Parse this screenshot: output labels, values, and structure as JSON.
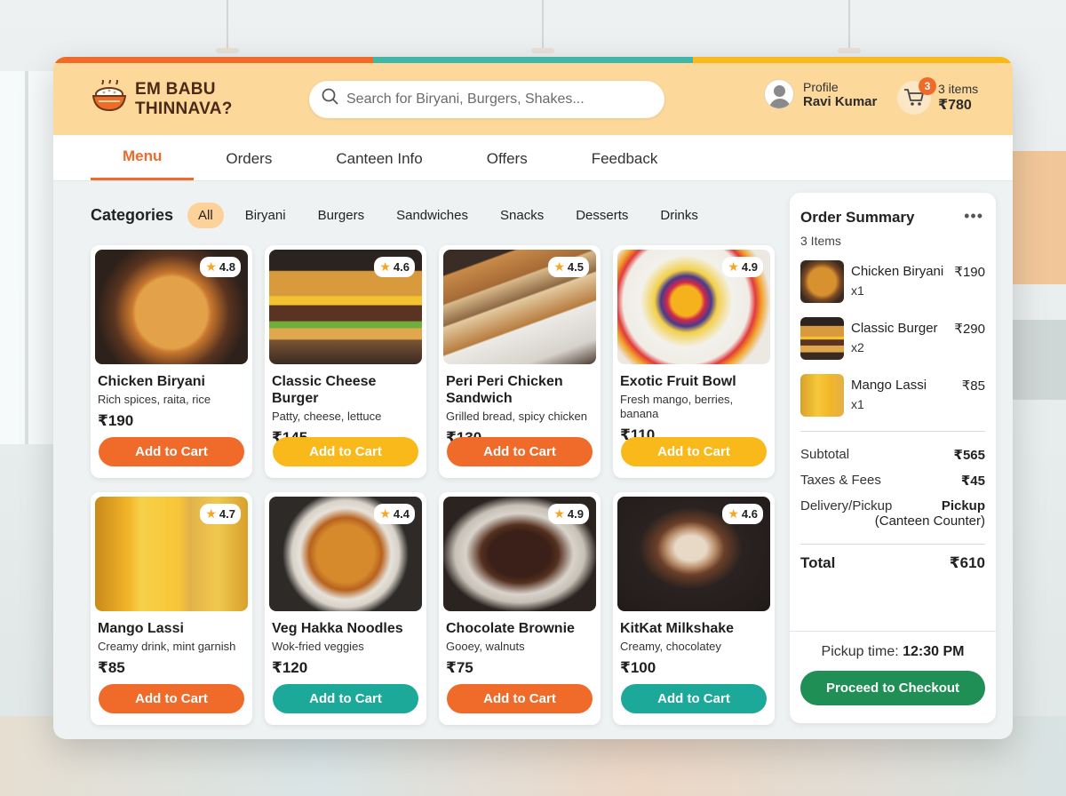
{
  "app": {
    "name": "EM BABU THINNAVA?",
    "name_line1": "EM BABU",
    "name_line2": "THINNAVA?"
  },
  "colors": {
    "header_bg": "#fdd89b",
    "accent_orange": "#f06a2a",
    "accent_yellow": "#f9b91b",
    "accent_teal": "#1ca99a",
    "checkout_green": "#1f8f55"
  },
  "search": {
    "placeholder": "Search for Biryani, Burgers, Shakes...",
    "value": ""
  },
  "profile": {
    "label": "Profile",
    "name": "Ravi Kumar"
  },
  "cart": {
    "badge": "3",
    "items": "3 items",
    "total": "₹780"
  },
  "nav": {
    "tabs": [
      "Menu",
      "Orders",
      "Canteen Info",
      "Offers",
      "Feedback"
    ],
    "active": "Menu"
  },
  "categories": {
    "title": "Categories",
    "items": [
      "All",
      "Biryani",
      "Burgers",
      "Sandwiches",
      "Snacks",
      "Desserts",
      "Drinks"
    ],
    "active": "All"
  },
  "products": [
    {
      "name": "Chicken Biryani",
      "desc": "Rich spices, raita, rice",
      "price": "₹190",
      "rating": "4.8",
      "button": "Add to Cart",
      "button_color": "orange",
      "image_icon": "biryani-image"
    },
    {
      "name": "Classic Cheese Burger",
      "desc": "Patty, cheese, lettuce",
      "price": "₹145",
      "rating": "4.6",
      "button": "Add to Cart",
      "button_color": "yellow",
      "image_icon": "burger-image"
    },
    {
      "name": "Peri Peri Chicken Sandwich",
      "desc": "Grilled bread, spicy chicken",
      "price": "₹130",
      "rating": "4.5",
      "button": "Add to Cart",
      "button_color": "orange",
      "image_icon": "sandwich-image"
    },
    {
      "name": "Exotic Fruit Bowl",
      "desc": "Fresh mango, berries, banana",
      "price": "₹110",
      "rating": "4.9",
      "button": "Add to Cart",
      "button_color": "yellow",
      "image_icon": "fruit-bowl-image"
    },
    {
      "name": "Mango Lassi",
      "desc": "Creamy drink, mint garnish",
      "price": "₹85",
      "rating": "4.7",
      "button": "Add to Cart",
      "button_color": "orange",
      "image_icon": "mango-lassi-image"
    },
    {
      "name": "Veg Hakka Noodles",
      "desc": "Wok-fried veggies",
      "price": "₹120",
      "rating": "4.4",
      "button": "Add to Cart",
      "button_color": "teal",
      "image_icon": "noodles-image"
    },
    {
      "name": "Chocolate Brownie",
      "desc": "Gooey, walnuts",
      "price": "₹75",
      "rating": "4.9",
      "button": "Add to Cart",
      "button_color": "orange",
      "image_icon": "brownie-image"
    },
    {
      "name": "KitKat Milkshake",
      "desc": "Creamy, chocolatey",
      "price": "₹100",
      "rating": "4.6",
      "button": "Add to Cart",
      "button_color": "teal",
      "image_icon": "milkshake-image"
    }
  ],
  "summary": {
    "title": "Order Summary",
    "more": "•••",
    "count": "3 Items",
    "items": [
      {
        "name": "Chicken Biryani",
        "qty": "x1",
        "price": "₹190"
      },
      {
        "name": "Classic Burger",
        "qty": "x2",
        "price": "₹290"
      },
      {
        "name": "Mango Lassi",
        "qty": "x1",
        "price": "₹85"
      }
    ],
    "subtotal_label": "Subtotal",
    "subtotal": "₹565",
    "taxes_label": "Taxes & Fees",
    "taxes": "₹45",
    "delivery_label": "Delivery/Pickup",
    "delivery_value_line1": "Pickup",
    "delivery_value_line2": "(Canteen Counter)",
    "total_label": "Total",
    "total": "₹610",
    "pickup_label": "Pickup time:",
    "pickup_time": "12:30 PM",
    "checkout_label": "Proceed to Checkout"
  }
}
